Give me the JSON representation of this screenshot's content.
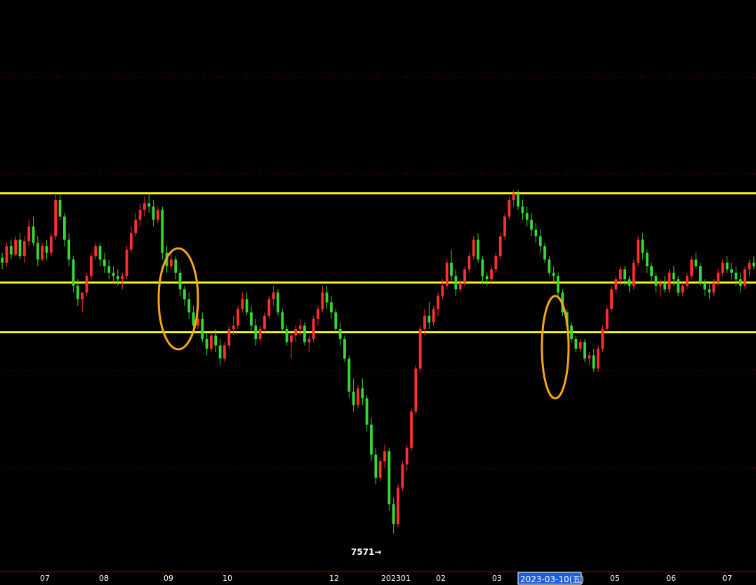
{
  "chart_data": {
    "type": "candlestick",
    "grid": true,
    "colors": {
      "background": "#000000",
      "up": "#ff2f2f",
      "down": "#34d934",
      "grid": "#8b0000",
      "level_line": "#f5f516",
      "ellipse": "#f5a516",
      "cursor_bg": "#1a5fd8"
    },
    "x_ticks": [
      "07",
      "08",
      "09",
      "10",
      "12",
      "202301",
      "02",
      "03",
      "05",
      "06",
      "07"
    ],
    "cursor_date": "2023-03-10(五)",
    "min_marker": {
      "label": "7571→",
      "value": 7571
    },
    "ylim": [
      7530,
      9100
    ],
    "horizontal_levels": [
      8600,
      8330,
      8180
    ],
    "highlighted_periods": [
      "09",
      "03"
    ],
    "candles": [
      [
        8405,
        8420,
        8370,
        8390
      ],
      [
        8390,
        8450,
        8380,
        8440
      ],
      [
        8440,
        8460,
        8400,
        8415
      ],
      [
        8415,
        8470,
        8410,
        8460
      ],
      [
        8460,
        8480,
        8400,
        8410
      ],
      [
        8410,
        8470,
        8390,
        8455
      ],
      [
        8455,
        8520,
        8440,
        8500
      ],
      [
        8500,
        8530,
        8440,
        8450
      ],
      [
        8450,
        8470,
        8380,
        8400
      ],
      [
        8400,
        8450,
        8395,
        8440
      ],
      [
        8440,
        8460,
        8400,
        8420
      ],
      [
        8420,
        8480,
        8410,
        8470
      ],
      [
        8470,
        8600,
        8460,
        8580
      ],
      [
        8580,
        8600,
        8520,
        8530
      ],
      [
        8530,
        8540,
        8440,
        8460
      ],
      [
        8460,
        8480,
        8380,
        8400
      ],
      [
        8400,
        8410,
        8300,
        8320
      ],
      [
        8320,
        8340,
        8260,
        8280
      ],
      [
        8280,
        8300,
        8240,
        8300
      ],
      [
        8300,
        8360,
        8290,
        8350
      ],
      [
        8350,
        8420,
        8340,
        8410
      ],
      [
        8410,
        8450,
        8400,
        8440
      ],
      [
        8440,
        8450,
        8380,
        8400
      ],
      [
        8400,
        8420,
        8360,
        8380
      ],
      [
        8380,
        8400,
        8340,
        8360
      ],
      [
        8360,
        8380,
        8330,
        8350
      ],
      [
        8350,
        8370,
        8320,
        8340
      ],
      [
        8340,
        8360,
        8310,
        8350
      ],
      [
        8350,
        8440,
        8340,
        8430
      ],
      [
        8430,
        8500,
        8420,
        8480
      ],
      [
        8480,
        8540,
        8470,
        8520
      ],
      [
        8520,
        8570,
        8500,
        8550
      ],
      [
        8550,
        8590,
        8530,
        8570
      ],
      [
        8570,
        8600,
        8540,
        8560
      ],
      [
        8560,
        8580,
        8500,
        8520
      ],
      [
        8520,
        8560,
        8510,
        8550
      ],
      [
        8550,
        8560,
        8400,
        8420
      ],
      [
        8420,
        8440,
        8360,
        8380
      ],
      [
        8380,
        8420,
        8370,
        8400
      ],
      [
        8400,
        8410,
        8340,
        8360
      ],
      [
        8360,
        8370,
        8290,
        8310
      ],
      [
        8310,
        8320,
        8260,
        8280
      ],
      [
        8280,
        8300,
        8220,
        8240
      ],
      [
        8240,
        8260,
        8180,
        8200
      ],
      [
        8200,
        8230,
        8190,
        8220
      ],
      [
        8220,
        8240,
        8150,
        8160
      ],
      [
        8160,
        8180,
        8110,
        8130
      ],
      [
        8130,
        8180,
        8120,
        8170
      ],
      [
        8170,
        8190,
        8120,
        8140
      ],
      [
        8140,
        8160,
        8080,
        8100
      ],
      [
        8100,
        8150,
        8090,
        8140
      ],
      [
        8140,
        8200,
        8130,
        8190
      ],
      [
        8190,
        8230,
        8170,
        8200
      ],
      [
        8200,
        8260,
        8190,
        8250
      ],
      [
        8250,
        8300,
        8240,
        8280
      ],
      [
        8280,
        8300,
        8230,
        8240
      ],
      [
        8240,
        8260,
        8180,
        8200
      ],
      [
        8200,
        8220,
        8140,
        8160
      ],
      [
        8160,
        8200,
        8150,
        8190
      ],
      [
        8190,
        8240,
        8180,
        8230
      ],
      [
        8230,
        8290,
        8220,
        8280
      ],
      [
        8280,
        8320,
        8260,
        8300
      ],
      [
        8300,
        8310,
        8230,
        8240
      ],
      [
        8240,
        8250,
        8180,
        8190
      ],
      [
        8190,
        8200,
        8140,
        8150
      ],
      [
        8150,
        8180,
        8100,
        8170
      ],
      [
        8170,
        8200,
        8150,
        8190
      ],
      [
        8190,
        8220,
        8170,
        8200
      ],
      [
        8200,
        8210,
        8140,
        8150
      ],
      [
        8150,
        8170,
        8120,
        8160
      ],
      [
        8160,
        8230,
        8150,
        8220
      ],
      [
        8220,
        8260,
        8200,
        8250
      ],
      [
        8250,
        8320,
        8240,
        8300
      ],
      [
        8300,
        8320,
        8250,
        8270
      ],
      [
        8270,
        8290,
        8220,
        8240
      ],
      [
        8240,
        8250,
        8180,
        8190
      ],
      [
        8190,
        8210,
        8140,
        8160
      ],
      [
        8160,
        8170,
        8090,
        8100
      ],
      [
        8100,
        8110,
        7980,
        8000
      ],
      [
        8000,
        8040,
        7940,
        7960
      ],
      [
        7960,
        8020,
        7950,
        8010
      ],
      [
        8010,
        8040,
        7960,
        7980
      ],
      [
        7980,
        7990,
        7880,
        7900
      ],
      [
        7900,
        7920,
        7790,
        7810
      ],
      [
        7810,
        7830,
        7720,
        7740
      ],
      [
        7740,
        7800,
        7730,
        7790
      ],
      [
        7790,
        7840,
        7770,
        7820
      ],
      [
        7820,
        7830,
        7640,
        7660
      ],
      [
        7660,
        7680,
        7571,
        7600
      ],
      [
        7600,
        7720,
        7590,
        7710
      ],
      [
        7710,
        7790,
        7700,
        7780
      ],
      [
        7780,
        7840,
        7760,
        7830
      ],
      [
        7830,
        7950,
        7820,
        7940
      ],
      [
        7940,
        8080,
        7930,
        8070
      ],
      [
        8070,
        8200,
        8060,
        8190
      ],
      [
        8190,
        8250,
        8170,
        8230
      ],
      [
        8230,
        8270,
        8190,
        8210
      ],
      [
        8210,
        8260,
        8200,
        8250
      ],
      [
        8250,
        8300,
        8230,
        8290
      ],
      [
        8290,
        8340,
        8280,
        8320
      ],
      [
        8320,
        8400,
        8310,
        8390
      ],
      [
        8390,
        8430,
        8330,
        8350
      ],
      [
        8350,
        8370,
        8290,
        8310
      ],
      [
        8310,
        8340,
        8300,
        8330
      ],
      [
        8330,
        8380,
        8320,
        8370
      ],
      [
        8370,
        8420,
        8360,
        8410
      ],
      [
        8410,
        8470,
        8400,
        8460
      ],
      [
        8460,
        8480,
        8390,
        8400
      ],
      [
        8400,
        8410,
        8330,
        8350
      ],
      [
        8350,
        8360,
        8320,
        8340
      ],
      [
        8340,
        8380,
        8330,
        8370
      ],
      [
        8370,
        8420,
        8360,
        8410
      ],
      [
        8410,
        8480,
        8400,
        8470
      ],
      [
        8470,
        8540,
        8460,
        8530
      ],
      [
        8530,
        8590,
        8520,
        8580
      ],
      [
        8580,
        8610,
        8560,
        8600
      ],
      [
        8600,
        8610,
        8550,
        8560
      ],
      [
        8560,
        8580,
        8520,
        8540
      ],
      [
        8540,
        8560,
        8500,
        8520
      ],
      [
        8520,
        8540,
        8470,
        8490
      ],
      [
        8490,
        8510,
        8450,
        8470
      ],
      [
        8470,
        8490,
        8420,
        8440
      ],
      [
        8440,
        8450,
        8390,
        8400
      ],
      [
        8400,
        8410,
        8350,
        8360
      ],
      [
        8360,
        8380,
        8330,
        8350
      ],
      [
        8350,
        8360,
        8290,
        8300
      ],
      [
        8300,
        8310,
        8230,
        8240
      ],
      [
        8240,
        8250,
        8190,
        8200
      ],
      [
        8200,
        8210,
        8150,
        8160
      ],
      [
        8160,
        8170,
        8120,
        8130
      ],
      [
        8130,
        8160,
        8120,
        8150
      ],
      [
        8150,
        8160,
        8090,
        8100
      ],
      [
        8100,
        8120,
        8080,
        8110
      ],
      [
        8110,
        8130,
        8060,
        8070
      ],
      [
        8070,
        8140,
        8060,
        8130
      ],
      [
        8130,
        8200,
        8120,
        8190
      ],
      [
        8190,
        8260,
        8180,
        8250
      ],
      [
        8250,
        8320,
        8240,
        8310
      ],
      [
        8310,
        8350,
        8300,
        8340
      ],
      [
        8340,
        8380,
        8320,
        8370
      ],
      [
        8370,
        8380,
        8320,
        8340
      ],
      [
        8340,
        8350,
        8300,
        8320
      ],
      [
        8320,
        8400,
        8310,
        8390
      ],
      [
        8390,
        8470,
        8380,
        8460
      ],
      [
        8460,
        8480,
        8400,
        8420
      ],
      [
        8420,
        8430,
        8360,
        8380
      ],
      [
        8380,
        8390,
        8330,
        8350
      ],
      [
        8350,
        8360,
        8300,
        8320
      ],
      [
        8320,
        8340,
        8290,
        8330
      ],
      [
        8330,
        8350,
        8300,
        8310
      ],
      [
        8310,
        8370,
        8300,
        8360
      ],
      [
        8360,
        8380,
        8320,
        8340
      ],
      [
        8340,
        8350,
        8290,
        8300
      ],
      [
        8300,
        8330,
        8290,
        8320
      ],
      [
        8320,
        8360,
        8310,
        8350
      ],
      [
        8350,
        8410,
        8340,
        8400
      ],
      [
        8400,
        8420,
        8370,
        8380
      ],
      [
        8380,
        8390,
        8320,
        8330
      ],
      [
        8330,
        8340,
        8290,
        8310
      ],
      [
        8310,
        8330,
        8280,
        8300
      ],
      [
        8300,
        8340,
        8290,
        8330
      ],
      [
        8330,
        8370,
        8320,
        8360
      ],
      [
        8360,
        8400,
        8350,
        8390
      ],
      [
        8390,
        8410,
        8360,
        8370
      ],
      [
        8370,
        8390,
        8340,
        8360
      ],
      [
        8360,
        8380,
        8320,
        8340
      ],
      [
        8340,
        8360,
        8300,
        8320
      ],
      [
        8320,
        8380,
        8310,
        8370
      ],
      [
        8370,
        8400,
        8350,
        8390
      ],
      [
        8390,
        8410,
        8370,
        8380
      ]
    ]
  }
}
